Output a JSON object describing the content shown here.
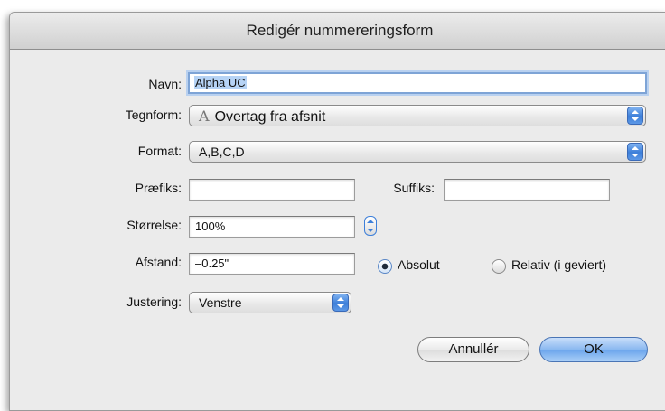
{
  "dialog": {
    "title": "Redigér nummereringsform"
  },
  "form": {
    "name_label": "Navn:",
    "name_value": "Alpha UC",
    "char_style_label": "Tegnform:",
    "char_style_value": "Overtag fra afsnit",
    "char_style_glyph": "A",
    "format_label": "Format:",
    "format_value": "A,B,C,D",
    "prefix_label": "Præfiks:",
    "prefix_value": "",
    "suffix_label": "Suffiks:",
    "suffix_value": "",
    "size_label": "Størrelse:",
    "size_value": "100%",
    "spacing_label": "Afstand:",
    "spacing_value": "–0.25\"",
    "spacing_absolute_label": "Absolut",
    "spacing_relative_label": "Relativ (i geviert)",
    "spacing_mode_selected": "Absolut",
    "alignment_label": "Justering:",
    "alignment_value": "Venstre"
  },
  "buttons": {
    "cancel_label": "Annullér",
    "ok_label": "OK"
  },
  "colors": {
    "accent": "#3d7fd9",
    "selection": "#b6d3f5"
  }
}
